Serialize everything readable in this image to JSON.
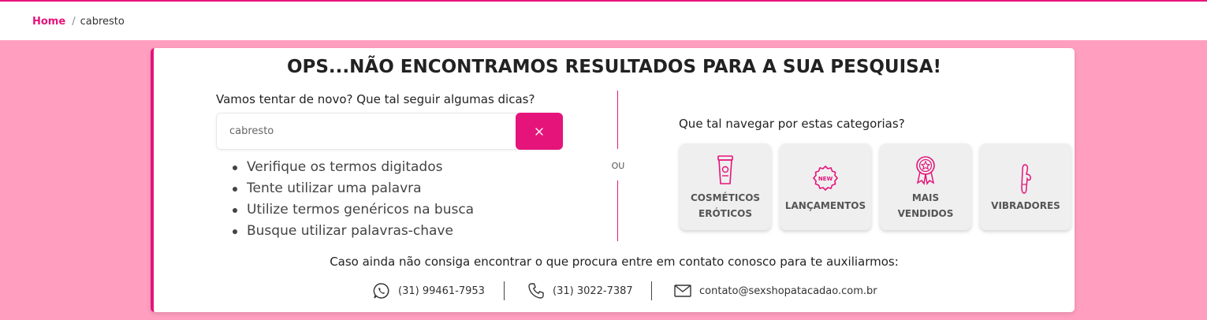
{
  "breadcrumb": {
    "home": "Home",
    "separator": "/",
    "current": "cabresto"
  },
  "main": {
    "title": "OPS...NÃO ENCONTRAMOS RESULTADOS PARA A SUA PESQUISA!",
    "tips_title": "Vamos tentar de novo? Que tal seguir algumas dicas?",
    "search": {
      "value": "cabresto",
      "clear_label": "×"
    },
    "tips": [
      "Verifique os termos digitados",
      "Tente utilizar uma palavra",
      "Utilize termos genéricos na busca",
      "Busque utilizar palavras-chave"
    ],
    "or_label": "OU",
    "categories_title": "Que tal navegar por estas categorias?",
    "categories": [
      {
        "line1": "COSMÉTICOS",
        "line2": "ERÓTICOS",
        "icon": "cosmetic-tube-icon"
      },
      {
        "line1": "LANÇAMENTOS",
        "line2": "",
        "icon": "new-badge-icon",
        "badge_text": "NEW"
      },
      {
        "line1": "MAIS",
        "line2": "VENDIDOS",
        "icon": "award-ribbon-icon"
      },
      {
        "line1": "VIBRADORES",
        "line2": "",
        "icon": "vibrator-icon"
      }
    ],
    "contact_title": "Caso ainda não consiga encontrar o que procura entre em contato conosco para te auxiliarmos:",
    "contacts": {
      "whatsapp": "(31) 99461-7953",
      "phone": "(31) 3022-7387",
      "email": "contato@sexshopatacadao.com.br"
    }
  },
  "colors": {
    "accent": "#e5147b",
    "background": "#ff9ebf",
    "card": "#ffffff",
    "category_bg": "#efefef"
  }
}
